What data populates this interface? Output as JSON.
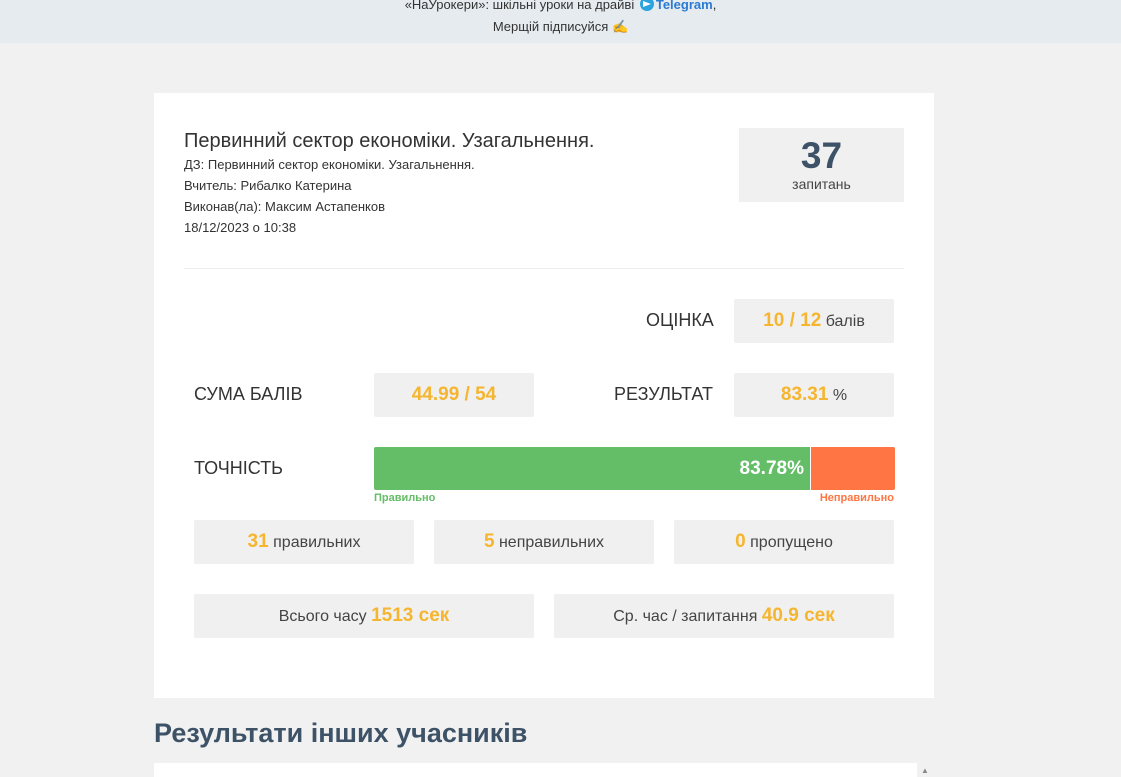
{
  "topbar": {
    "text_before": "«НаУрокери»: шкільні уроки на драйві",
    "telegram_label": "Telegram",
    "text_after": ",",
    "line2_text": "Мерщій підписуйся",
    "telegram_icon": "telegram-icon",
    "hand_icon": "✍"
  },
  "header": {
    "title": "Первинний сектор економіки. Узагальнення.",
    "homework": "ДЗ: Первинний сектор економіки. Узагальнення.",
    "teacher": "Вчитель: Рибалко Катерина",
    "performer": "Виконав(ла): Максим Астапенков",
    "datetime": "18/12/2023 о 10:38"
  },
  "questions": {
    "count": "37",
    "label": "запитань"
  },
  "grade": {
    "label": "ОЦІНКА",
    "value": "10 / 12",
    "unit": "балів"
  },
  "score_sum": {
    "label": "СУМА БАЛІВ",
    "value": "44.99 / 54"
  },
  "result": {
    "label": "РЕЗУЛЬТАТ",
    "value": "83.31",
    "unit": "%"
  },
  "accuracy": {
    "label": "ТОЧНІСТЬ",
    "percent_text": "83.78%",
    "fraction": 0.8378,
    "correct_label": "Правильно",
    "incorrect_label": "Неправильно",
    "correct_color": "#64bd67",
    "incorrect_color": "#ff7543"
  },
  "counts": {
    "correct_value": "31",
    "correct_label": "правильних",
    "incorrect_value": "5",
    "incorrect_label": "неправильних",
    "skipped_value": "0",
    "skipped_label": "пропущено"
  },
  "time": {
    "total_label": "Всього часу",
    "total_value": "1513 сек",
    "avg_label": "Ср. час / запитання",
    "avg_value": "40.9 сек"
  },
  "others_section": {
    "title": "Результати інших учасників"
  },
  "colors": {
    "accent": "#f6b52f",
    "heading": "#3d5266",
    "page_bg": "#f1f1f1"
  }
}
